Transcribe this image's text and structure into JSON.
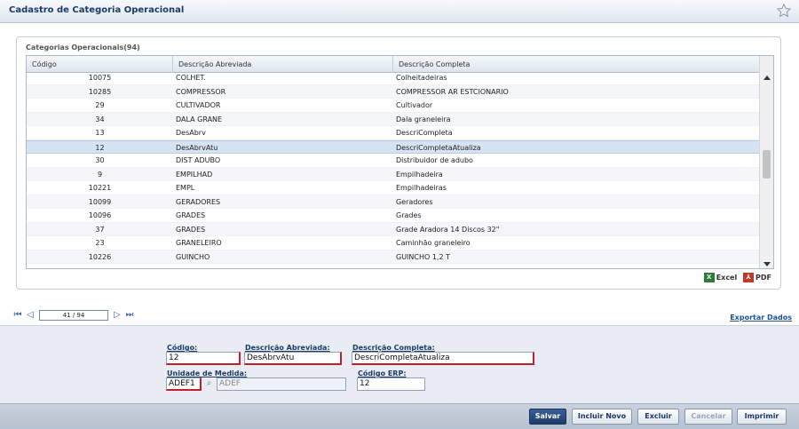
{
  "window": {
    "title": "Cadastro de Categoria Operacional"
  },
  "grid": {
    "caption": "Categorias Operacionais(94)",
    "columns": [
      "Código",
      "Descrição Abreviada",
      "Descrição Completa"
    ],
    "rows": [
      {
        "codigo": "10075",
        "abreviada": "COLHET.",
        "completa": "Colheitadeiras"
      },
      {
        "codigo": "10285",
        "abreviada": "COMPRESSOR",
        "completa": "COMPRESSOR AR ESTCIONARIO"
      },
      {
        "codigo": "29",
        "abreviada": "CULTIVADOR",
        "completa": "Cultivador"
      },
      {
        "codigo": "34",
        "abreviada": "DALA GRANE",
        "completa": "Dala graneleira"
      },
      {
        "codigo": "13",
        "abreviada": "DesAbrv",
        "completa": "DescriCompleta"
      },
      {
        "codigo": "12",
        "abreviada": "DesAbrvAtu",
        "completa": "DescriCompletaAtualiza"
      },
      {
        "codigo": "30",
        "abreviada": "DIST ADUBO",
        "completa": "Distribuidor de adubo"
      },
      {
        "codigo": "9",
        "abreviada": "EMPILHAD",
        "completa": "Empilhadeira"
      },
      {
        "codigo": "10221",
        "abreviada": "EMPL",
        "completa": "Empilhadeiras"
      },
      {
        "codigo": "10099",
        "abreviada": "GERADORES",
        "completa": "Geradores"
      },
      {
        "codigo": "10096",
        "abreviada": "GRADES",
        "completa": "Grades"
      },
      {
        "codigo": "37",
        "abreviada": "GRADES",
        "completa": "Grade Aradora 14 Discos 32\""
      },
      {
        "codigo": "23",
        "abreviada": "GRANELEIRO",
        "completa": "Caminhão graneleiro"
      },
      {
        "codigo": "10226",
        "abreviada": "GUINCHO",
        "completa": "GUINCHO 1,2 T"
      }
    ],
    "selected_index": 5
  },
  "exports": {
    "excel": "Excel",
    "pdf": "PDF"
  },
  "pager": {
    "page_display": "41 / 94"
  },
  "export_link": "Exportar Dados",
  "form": {
    "codigo_label": "Código:",
    "codigo_value": "12",
    "abreviada_label": "Descrição Abreviada:",
    "abreviada_value": "DesAbrvAtu",
    "completa_label": "Descrição Completa:",
    "completa_value": "DescriCompletaAtualiza",
    "unidade_label": "Unidade de Medida:",
    "unidade_code": "ADEF1",
    "unidade_desc": "ADEF",
    "erp_label": "Código ERP:",
    "erp_value": "12"
  },
  "buttons": {
    "salvar": "Salvar",
    "incluir": "Incluir Novo",
    "excluir": "Excluir",
    "cancelar": "Cancelar",
    "imprimir": "Imprimir"
  },
  "icons": {
    "favorite": "star-icon",
    "search": "search-icon",
    "excel": "excel-icon",
    "pdf": "pdf-icon"
  }
}
